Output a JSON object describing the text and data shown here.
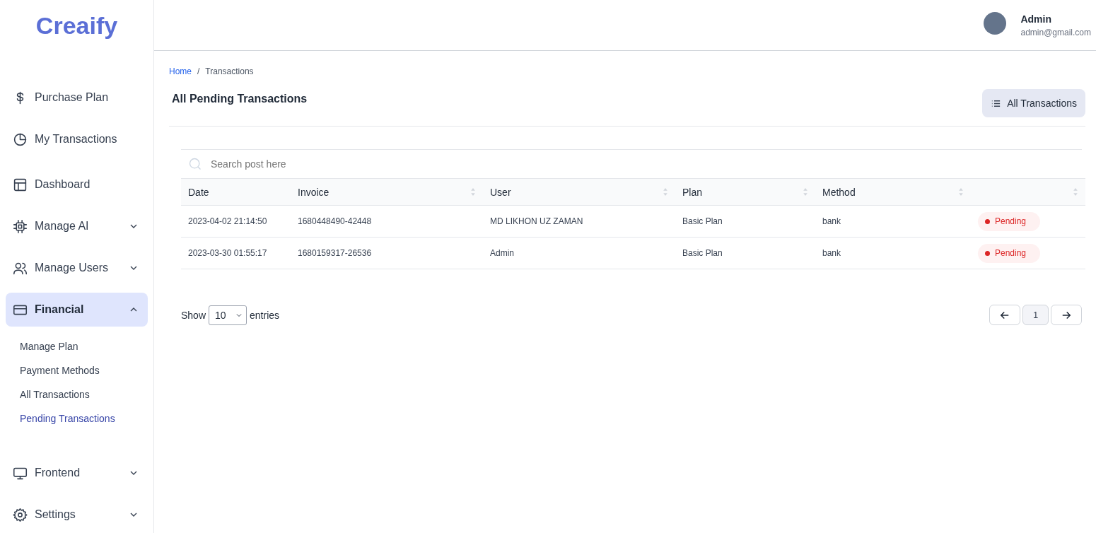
{
  "brand": "Creaify",
  "sidebar": {
    "groups": [
      [
        {
          "label": "Purchase Plan",
          "selected": false
        },
        {
          "label": "My Transactions",
          "selected": false
        }
      ],
      [
        {
          "label": "Dashboard",
          "selected": false
        },
        {
          "label": "Manage AI",
          "selected": false,
          "expanded": false
        },
        {
          "label": "Manage Users",
          "selected": false,
          "expanded": false
        },
        {
          "label": "Financial",
          "selected": true,
          "expanded": true,
          "children": [
            {
              "label": "Manage Plan",
              "selected": false
            },
            {
              "label": "Payment Methods",
              "selected": false
            },
            {
              "label": "All Transactions",
              "selected": false
            },
            {
              "label": "Pending Transactions",
              "selected": true
            }
          ]
        },
        {
          "label": "Frontend",
          "selected": false,
          "expanded": false
        },
        {
          "label": "Settings",
          "selected": false,
          "expanded": false
        }
      ]
    ]
  },
  "user": {
    "name": "Admin",
    "email": "admin@gmail.com"
  },
  "breadcrumb": {
    "items": [
      "Home",
      "Transactions"
    ],
    "separator": "/"
  },
  "page_title": "All Pending Transactions",
  "action_button": "All Transactions",
  "search": {
    "placeholder": "Search post here"
  },
  "table": {
    "columns": [
      {
        "label": "Date",
        "sortable": false
      },
      {
        "label": "Invoice",
        "sortable": true
      },
      {
        "label": "User",
        "sortable": true
      },
      {
        "label": "Plan",
        "sortable": true
      },
      {
        "label": "Method",
        "sortable": true
      },
      {
        "sortable": true
      }
    ],
    "rows": [
      {
        "cells": [
          "2023-04-02 21:14:50",
          "1680448490-42448",
          "MD LIKHON UZ ZAMAN",
          "Basic Plan",
          "bank"
        ],
        "status": {
          "label": "Pending",
          "kind": "pending"
        }
      },
      {
        "cells": [
          "2023-03-30 01:55:17",
          "1680159317-26536",
          "Admin",
          "Basic Plan",
          "bank"
        ],
        "status": {
          "label": "Pending",
          "kind": "pending"
        }
      }
    ]
  },
  "entries": {
    "before": "Show",
    "value": "10",
    "after": "entries"
  },
  "pagination": [
    {
      "label": "1",
      "selected": true
    }
  ]
}
